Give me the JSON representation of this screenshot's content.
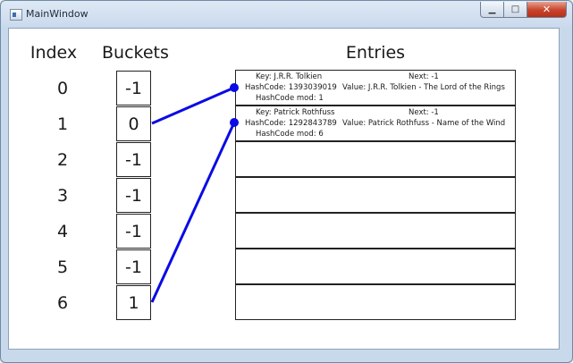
{
  "window": {
    "title": "MainWindow"
  },
  "headers": {
    "index": "Index",
    "buckets": "Buckets",
    "entries": "Entries"
  },
  "indices": [
    "0",
    "1",
    "2",
    "3",
    "4",
    "5",
    "6"
  ],
  "buckets": [
    "-1",
    "0",
    "-1",
    "-1",
    "-1",
    "-1",
    "1"
  ],
  "entries": [
    {
      "key": "Key: J.R.R. Tolkien",
      "next": "Next: -1",
      "hashcode": "HashCode: 1393039019",
      "value": "Value: J.R.R. Tolkien - The Lord of the Rings",
      "mod": "HashCode mod: 1"
    },
    {
      "key": "Key: Patrick Rothfuss",
      "next": "Next: -1",
      "hashcode": "HashCode: 1292843789",
      "value": "Value: Patrick Rothfuss - Name of the Wind",
      "mod": "HashCode mod: 6"
    },
    {},
    {},
    {},
    {},
    {}
  ],
  "colors": {
    "link": "#0a0ae6"
  }
}
